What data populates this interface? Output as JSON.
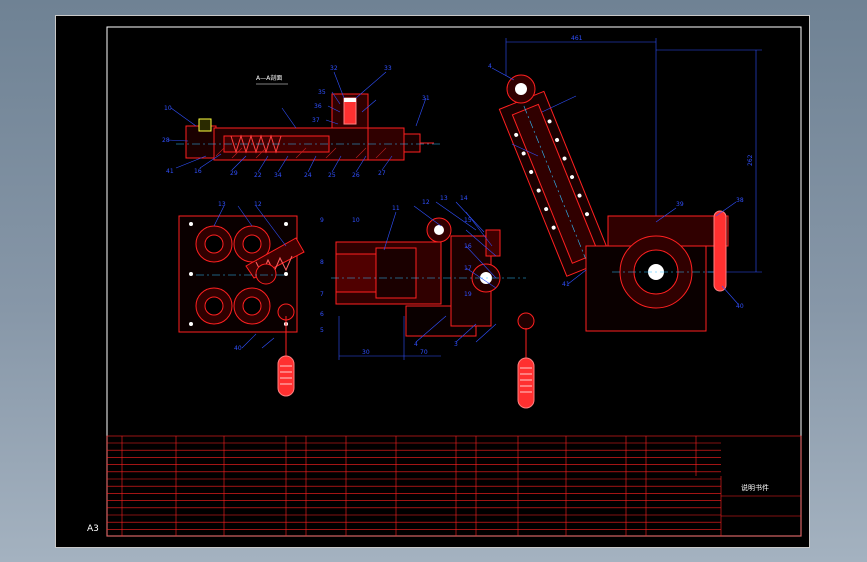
{
  "sheet": {
    "size_label": "A3",
    "title_text": "说明书件",
    "colors": {
      "background": "#000000",
      "frame": "#ffffff",
      "part_outline": "#ff2020",
      "dimension": "#3050ff",
      "centerline": "#30c0ff",
      "table": "#ff2020"
    }
  },
  "section_a": {
    "label": "A—A剖面"
  },
  "dimensions": {
    "top_overall": "461",
    "vertical": "262",
    "front_horizontal_left": "30",
    "front_horizontal_right": "70"
  },
  "balloons": {
    "section": [
      "10",
      "28",
      "41",
      "16",
      "29",
      "22",
      "34",
      "24",
      "25",
      "26",
      "27",
      "31",
      "32",
      "33",
      "35",
      "36",
      "37"
    ],
    "plan": [
      "13",
      "40",
      "12"
    ],
    "front": [
      "11",
      "12",
      "13",
      "14",
      "15",
      "16",
      "17",
      "19",
      "9",
      "10",
      "8",
      "7",
      "6",
      "5",
      "4",
      "3"
    ],
    "side": [
      "4",
      "41",
      "38",
      "40",
      "39"
    ]
  }
}
